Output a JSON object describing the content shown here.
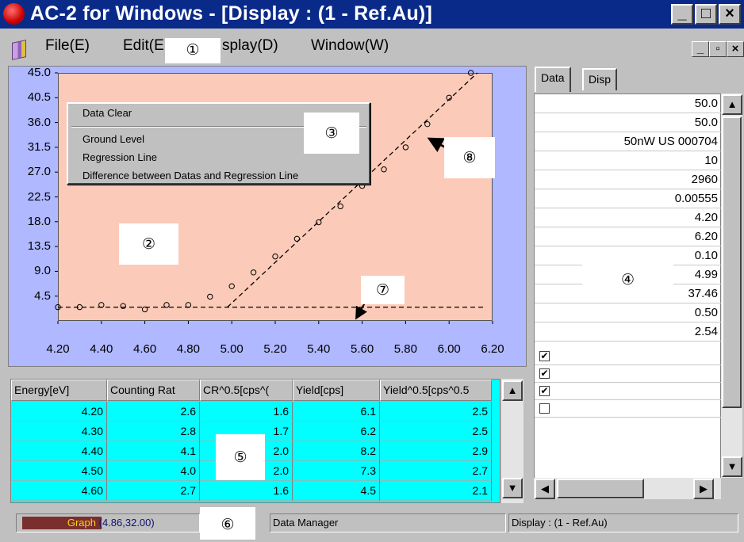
{
  "window": {
    "title": "AC-2 for Windows - [Display : (1 - Ref.Au)]",
    "controls": {
      "minimize": "_",
      "maximize": "□",
      "close": "×"
    }
  },
  "menu": {
    "items": [
      {
        "label": "File(E)",
        "id": "file"
      },
      {
        "label": "Edit(E",
        "id": "edit"
      },
      {
        "label": "splay(D)",
        "id": "display"
      },
      {
        "label": "Window(W)",
        "id": "window"
      }
    ],
    "mdi_controls": {
      "minimize": "_",
      "restore": "▫",
      "close": "×"
    }
  },
  "callouts": {
    "c1": "①",
    "c2": "②",
    "c3": "③",
    "c4": "④",
    "c5": "⑤",
    "c6": "⑥",
    "c7": "⑦",
    "c8": "⑧"
  },
  "context_menu": {
    "items": [
      "Data Clear",
      "Ground Level",
      "Regression Line",
      "Difference between Datas and Regression Line"
    ]
  },
  "chart_data": {
    "type": "scatter",
    "x_ticks": [
      "4.20",
      "4.40",
      "4.60",
      "4.80",
      "5.00",
      "5.20",
      "5.40",
      "5.60",
      "5.80",
      "6.00",
      "6.20"
    ],
    "y_ticks": [
      "45.0",
      "40.5",
      "36.0",
      "31.5",
      "27.0",
      "22.5",
      "18.0",
      "13.5",
      "9.0",
      "4.5"
    ],
    "xlim": [
      4.2,
      6.2
    ],
    "ylim": [
      0,
      45
    ],
    "points": [
      [
        4.2,
        2.5
      ],
      [
        4.3,
        2.5
      ],
      [
        4.4,
        2.9
      ],
      [
        4.5,
        2.7
      ],
      [
        4.6,
        2.1
      ],
      [
        4.7,
        2.9
      ],
      [
        4.8,
        2.9
      ],
      [
        4.9,
        4.4
      ],
      [
        5.0,
        6.3
      ],
      [
        5.1,
        8.8
      ],
      [
        5.2,
        11.7
      ],
      [
        5.3,
        14.9
      ],
      [
        5.4,
        17.9
      ],
      [
        5.5,
        20.8
      ],
      [
        5.6,
        24.5
      ],
      [
        5.7,
        27.5
      ],
      [
        5.8,
        31.5
      ],
      [
        5.9,
        35.7
      ],
      [
        6.0,
        40.5
      ],
      [
        6.1,
        45.0
      ]
    ],
    "ground_level": 2.5,
    "regression": {
      "x0": 4.98,
      "y0": 2.5,
      "x1": 6.13,
      "y1": 45.0
    },
    "grid": false
  },
  "right_panel": {
    "tabs": [
      "Data",
      "Disp"
    ],
    "values": [
      "50.0",
      "50.0",
      "50nW US 000704",
      "10",
      "2960",
      "0.00555",
      "4.20",
      "6.20",
      "0.10",
      "4.99",
      "37.46",
      "0.50",
      "2.54"
    ],
    "checkboxes": [
      true,
      true,
      true,
      false
    ]
  },
  "table": {
    "headers": [
      "Energy[eV]",
      "Counting Rat",
      "CR^0.5[cps^(",
      "Yield[cps]",
      "Yield^0.5[cps^0.5"
    ],
    "rows": [
      [
        "4.20",
        "2.6",
        "1.6",
        "6.1",
        "2.5"
      ],
      [
        "4.30",
        "2.8",
        "1.7",
        "6.2",
        "2.5"
      ],
      [
        "4.40",
        "4.1",
        "2.0",
        "8.2",
        "2.9"
      ],
      [
        "4.50",
        "4.0",
        "2.0",
        "7.3",
        "2.7"
      ],
      [
        "4.60",
        "2.7",
        "1.6",
        "4.5",
        "2.1"
      ]
    ]
  },
  "statusbar": {
    "graph_label": "Graph (4.86,32.00)",
    "data_manager": "Data Manager",
    "display_info": "Display : (1 - Ref.Au)"
  },
  "colors": {
    "title_bg": "#0a2a8a",
    "plot_bg": "#fccab8",
    "graph_panel_bg": "#b0b8ff",
    "table_bg": "#00ffff"
  }
}
